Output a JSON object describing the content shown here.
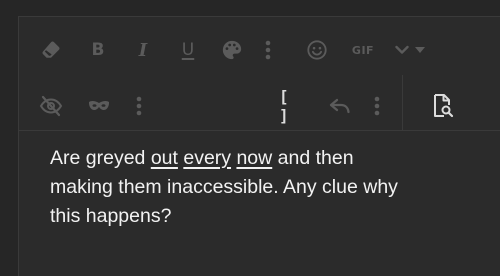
{
  "toolbar": {
    "row1": [
      {
        "name": "eraser-icon"
      },
      {
        "name": "bold-button",
        "label": "B"
      },
      {
        "name": "italic-button",
        "label": "I"
      },
      {
        "name": "underline-button",
        "label": "U"
      },
      {
        "name": "palette-icon"
      },
      {
        "name": "more-vertical-icon"
      },
      {
        "name": "smiley-icon"
      },
      {
        "name": "gif-button",
        "label": "GIF"
      },
      {
        "name": "chevron-down-icon"
      },
      {
        "name": "caret-down-icon"
      }
    ],
    "row2": [
      {
        "name": "eye-slash-icon"
      },
      {
        "name": "mask-icon"
      },
      {
        "name": "more-vertical-icon"
      },
      {
        "name": "brackets-button",
        "label": "[ ]"
      },
      {
        "name": "undo-icon"
      },
      {
        "name": "more-vertical-icon"
      },
      {
        "name": "preview-icon"
      }
    ]
  },
  "content": {
    "line1_start": "Are greyed ",
    "word_out": "out",
    "space1": " ",
    "word_every": "every",
    "space2": " ",
    "word_now": "now",
    "line1_end": " and then",
    "line2": "making them inaccessible. Any clue why",
    "line3": "this happens?"
  },
  "colors": {
    "background": "#262626",
    "editor": "#2b2b2b",
    "icon_dim": "#5b5b5b",
    "icon_bright": "#dcdcdc",
    "text": "#f2f2f2"
  }
}
